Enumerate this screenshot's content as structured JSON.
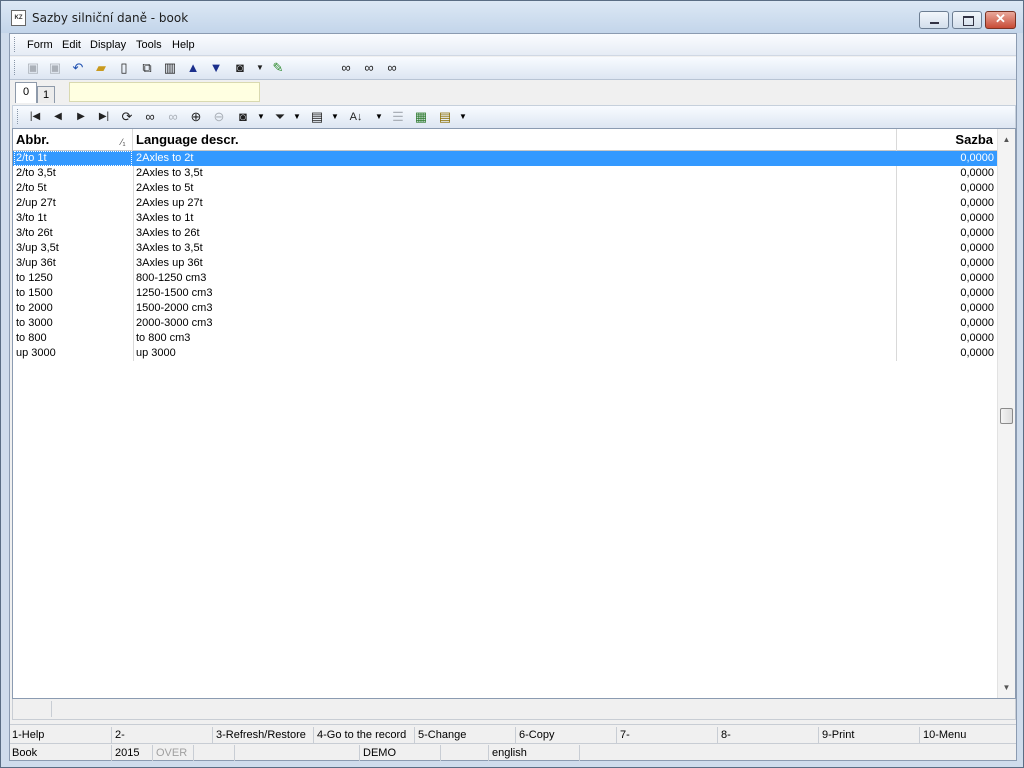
{
  "window": {
    "title": "Sazby silniční daně - book",
    "icon_text": "KZ"
  },
  "menu": {
    "items": [
      "Form",
      "Edit",
      "Display",
      "Tools",
      "Help"
    ]
  },
  "toolbar": {
    "icons": [
      "save-icon",
      "save-all-icon",
      "undo-icon",
      "open-folder-icon",
      "new-document-icon",
      "copy-document-icon",
      "book-icon",
      "arrow-up-icon",
      "arrow-down-icon",
      "camera-icon",
      "dropdown-arrow-icon",
      "export-icon",
      "binoculars-icon",
      "find-next-icon",
      "find-previous-icon"
    ]
  },
  "tabs": [
    {
      "label": "0"
    },
    {
      "label": "1"
    }
  ],
  "filter": {
    "value": ""
  },
  "grid_toolbar": {
    "icons": [
      "first-record-icon",
      "previous-record-icon",
      "next-record-icon",
      "last-record-icon",
      "refresh-icon",
      "binoculars-icon",
      "find-disabled-icon",
      "add-column-icon",
      "remove-column-icon",
      "camera-icon",
      "dropdown-arrow-icon",
      "filter-icon",
      "dropdown-arrow-icon",
      "columns-icon",
      "dropdown-arrow-icon",
      "sort-icon",
      "dropdown-arrow-icon",
      "numbering-icon",
      "excel-icon",
      "notes-icon",
      "dropdown-arrow-icon"
    ]
  },
  "grid": {
    "columns": {
      "abbr": "Abbr.",
      "lang": "Language descr.",
      "sazba": "Sazba"
    },
    "sort_indicator": "⁄₁",
    "rows": [
      {
        "abbr": "2/to 1t",
        "lang": "2Axles to 2t",
        "sazba": "0,0000"
      },
      {
        "abbr": "2/to 3,5t",
        "lang": "2Axles to 3,5t",
        "sazba": "0,0000"
      },
      {
        "abbr": "2/to 5t",
        "lang": "2Axles to 5t",
        "sazba": "0,0000"
      },
      {
        "abbr": "2/up 27t",
        "lang": "2Axles up 27t",
        "sazba": "0,0000"
      },
      {
        "abbr": "3/to 1t",
        "lang": "3Axles to 1t",
        "sazba": "0,0000"
      },
      {
        "abbr": "3/to 26t",
        "lang": "3Axles to 26t",
        "sazba": "0,0000"
      },
      {
        "abbr": "3/up 3,5t",
        "lang": "3Axles to 3,5t",
        "sazba": "0,0000"
      },
      {
        "abbr": "3/up 36t",
        "lang": "3Axles up 36t",
        "sazba": "0,0000"
      },
      {
        "abbr": "to 1250",
        "lang": "800-1250 cm3",
        "sazba": "0,0000"
      },
      {
        "abbr": "to 1500",
        "lang": "1250-1500 cm3",
        "sazba": "0,0000"
      },
      {
        "abbr": "to 2000",
        "lang": "1500-2000 cm3",
        "sazba": "0,0000"
      },
      {
        "abbr": "to 3000",
        "lang": "2000-3000 cm3",
        "sazba": "0,0000"
      },
      {
        "abbr": "to 800",
        "lang": "to 800 cm3",
        "sazba": "0,0000"
      },
      {
        "abbr": "up 3000",
        "lang": "up 3000",
        "sazba": "0,0000"
      }
    ],
    "selected_row": 0
  },
  "function_keys": [
    "1-Help",
    "2-",
    "3-Refresh/Restore",
    "4-Go to the record",
    "5-Change",
    "6-Copy",
    "7-",
    "8-",
    "9-Print",
    "10-Menu"
  ],
  "status": {
    "book": "Book",
    "year": "2015",
    "mode": "OVER",
    "db": "DEMO",
    "language": "english"
  },
  "colors": {
    "selection": "#3399ff",
    "filter_bg": "#ffffe1",
    "titlebar": "#c3d5ea"
  }
}
